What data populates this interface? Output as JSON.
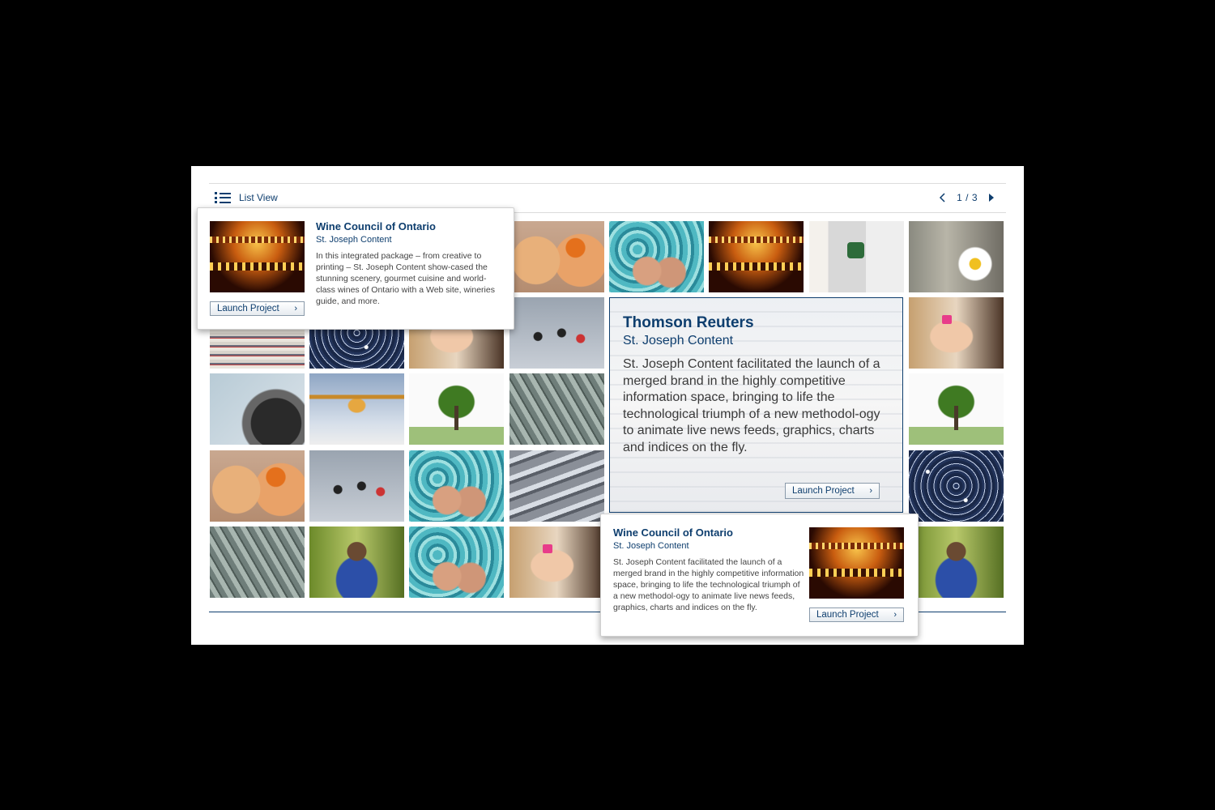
{
  "toolbar": {
    "list_view_label": "List View",
    "icon": "list-icon",
    "pager": {
      "current": 1,
      "total": 3,
      "text": "1 / 3",
      "prev_icon": "chevron-left-icon",
      "next_icon": "chevron-right-icon"
    }
  },
  "colors": {
    "accent": "#0e3e6e",
    "background": "#000000",
    "panel": "#ffffff"
  },
  "grid": {
    "rows": 5,
    "columns": 8,
    "tiles": [
      "theater",
      "eggs",
      "feet",
      "theater",
      "laptop",
      "daisy",
      "magazines",
      "lights",
      "girl",
      "people",
      "girl",
      "tire",
      "carousel",
      "tree",
      "escalator",
      "tree",
      "eggs",
      "people",
      "feet",
      "pipes",
      "lights",
      "escalator",
      "volunteer",
      "feet",
      "girl",
      "volunteer"
    ]
  },
  "cards": [
    {
      "title": "Wine Council of Ontario",
      "subtitle": "St. Joseph Content",
      "body": "In this integrated package – from creative to printing – St. Joseph Content show-cased the stunning scenery, gourmet cuisine and world-class wines of Ontario with a Web site, wineries guide, and more.",
      "button": "Launch Project",
      "thumbnail": "theater"
    },
    {
      "title": "Wine Council of Ontario",
      "subtitle": "St. Joseph Content",
      "body": "St. Joseph Content facilitated the launch of a merged brand in the highly competitive information space, bringing to life the technological triumph of a new methodol-ogy to animate live news feeds, graphics, charts and indices on the fly.",
      "button": "Launch Project",
      "thumbnail": "theater"
    }
  ],
  "feature": {
    "title": "Thomson Reuters",
    "subtitle": "St. Joseph Content",
    "body": "St. Joseph Content facilitated the launch of a merged brand in the highly competitive information space, bringing to life the technological triumph of a new methodol-ogy to animate live news feeds, graphics, charts and indices on the fly.",
    "button": "Launch Project"
  }
}
